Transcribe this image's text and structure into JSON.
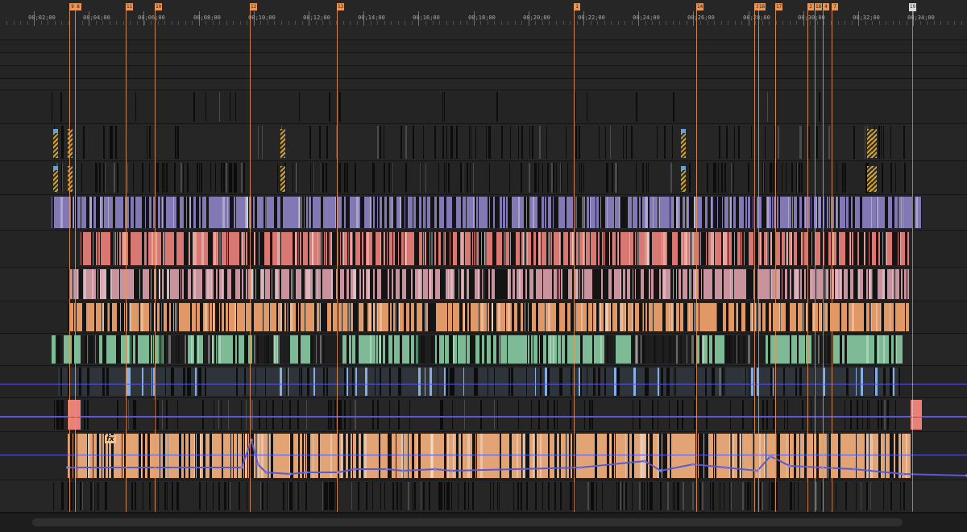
{
  "ruler": {
    "labels": [
      "00;02;00",
      "00;04;00",
      "00;06;00",
      "00;08;00",
      "00;10;00",
      "00;12;00",
      "00;14;00",
      "00;16;00",
      "00;18;00",
      "00;20;00",
      "00;22;00",
      "00;24;00",
      "00;26;00",
      "00;28;00",
      "00;30;00",
      "00;32;00",
      "00;34;00"
    ]
  },
  "markers": [
    "9",
    "8",
    "11",
    "10",
    "12",
    "13",
    "1",
    "14",
    "3",
    "16",
    "17",
    "2",
    "18",
    "4",
    "7"
  ],
  "playhead": {
    "glyph": "▼",
    "label": "19"
  },
  "fx_badge": "fx",
  "colors": {
    "marker": "#e8965a",
    "purple": "#8a7fc0",
    "salmon": "#e9807a",
    "pink": "#d79ca7",
    "orange": "#f0a36c",
    "green": "#86c7a0",
    "blue": "#86aee0",
    "keyframe": "#5a5ad6",
    "hatch": "#d4a32a"
  }
}
